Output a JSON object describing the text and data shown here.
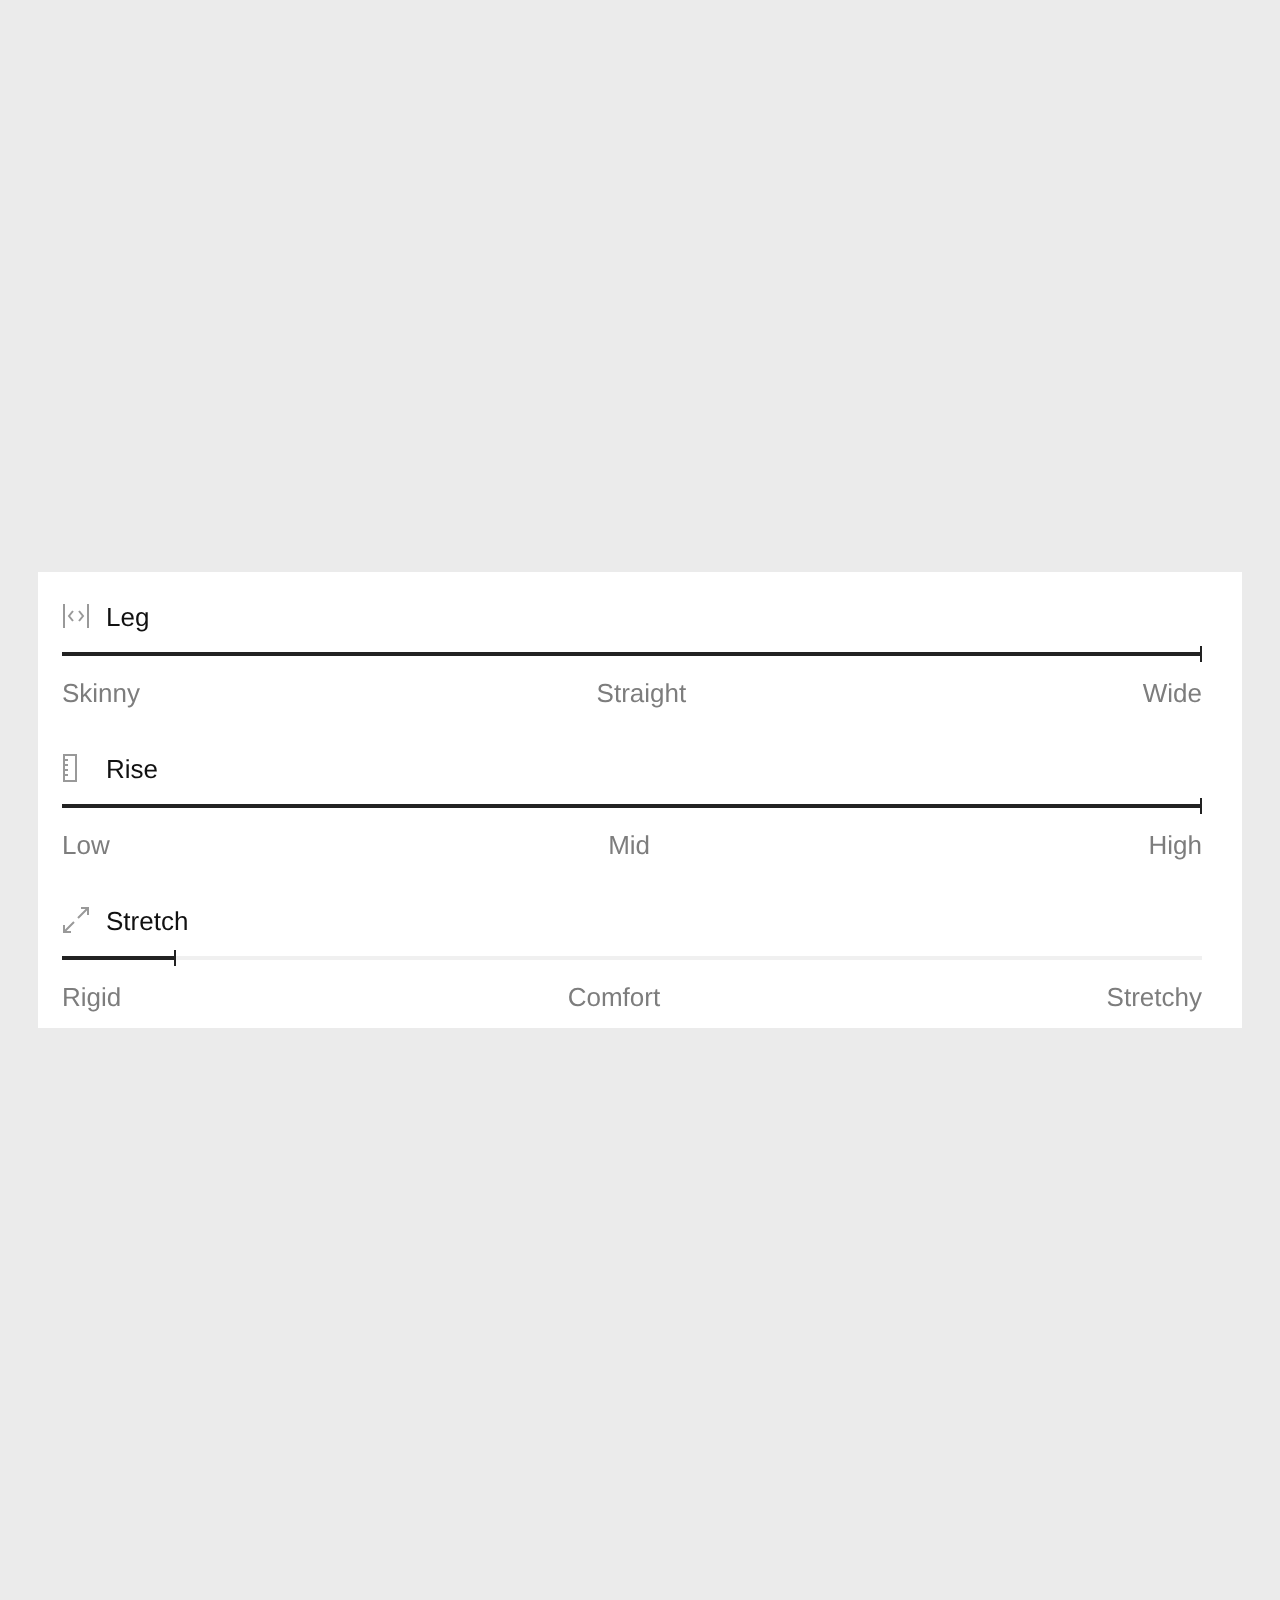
{
  "sliders": [
    {
      "kind": "leg",
      "title": "Leg",
      "level": 1.0,
      "labels": [
        "Skinny",
        "Straight",
        "Wide"
      ]
    },
    {
      "kind": "rise",
      "title": "Rise",
      "level": 1.0,
      "labels": [
        "Low",
        "Mid",
        "High"
      ]
    },
    {
      "kind": "stretch",
      "title": "Stretch",
      "level": 0.1,
      "labels": [
        "Rigid",
        "Comfort",
        "Stretchy"
      ]
    }
  ]
}
